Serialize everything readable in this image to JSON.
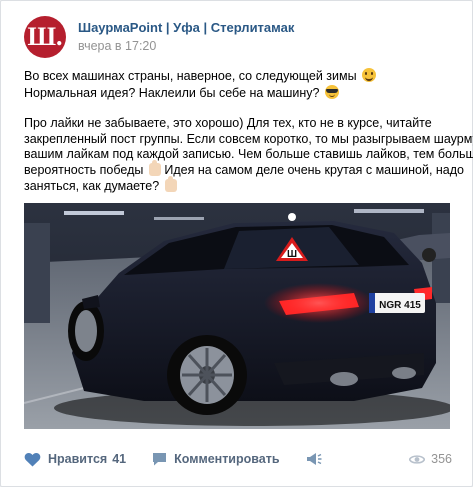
{
  "post": {
    "avatar_letter": "Ш.",
    "group_name": "ШаурмаPoint | Уфа | Стерлитамак",
    "time": "вчера в 17:20",
    "text_lines": [
      "Во всех машинах страны, наверное, со следующей зимы",
      "Нормальная идея? Наклеили бы себе на машину?",
      "Про лайки не забываете, это хорошо) Для тех, кто не в курсе, читайте",
      "закрепленный пост группы. Если совсем коротко, то мы разыгрываем шаурму по",
      "вашим лайкам под каждой записью. Чем больше ставишь лайков, тем больше",
      "вероятность победы",
      "Идея на самом деле очень крутая с машиной, надо",
      "заняться, как думаете?"
    ],
    "photo": {
      "plate": "NGR 415",
      "alt_label": "Audi RS6 в подземном паркинге"
    }
  },
  "actions": {
    "like_label": "Нравится",
    "like_count": "41",
    "comment_label": "Комментировать",
    "views_count": "356"
  },
  "icons": [
    "heart-icon",
    "comment-icon",
    "share-icon",
    "eye-icon",
    "smile-emoji",
    "sunglasses-emoji",
    "thumbs-up-emoji"
  ],
  "colors": {
    "avatar": "#b51f2e",
    "link": "#2a5885",
    "meta": "#939393",
    "action": "#55677d"
  }
}
